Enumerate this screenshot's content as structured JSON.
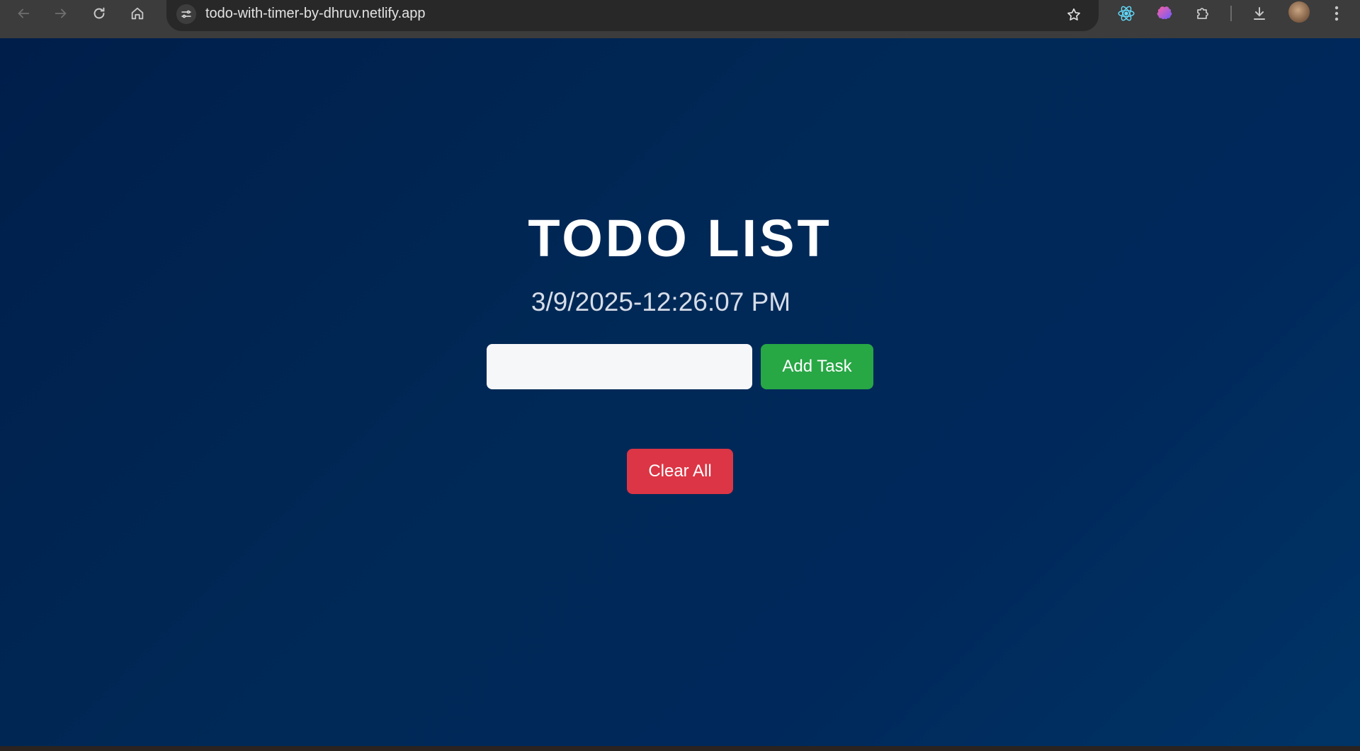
{
  "browser": {
    "url": "todo-with-timer-by-dhruv.netlify.app",
    "icons": {
      "back": "back-arrow-icon",
      "forward": "forward-arrow-icon",
      "reload": "reload-icon",
      "home": "home-icon",
      "site_info": "tune-icon",
      "bookmark": "star-icon",
      "extension_react": "react-devtools-icon",
      "extension_brain": "brain-extension-icon",
      "extensions": "puzzle-icon",
      "downloads": "download-icon",
      "menu": "kebab-menu-icon"
    }
  },
  "app": {
    "title": "TODO LIST",
    "datetime": "3/9/2025-12:26:07 PM",
    "task_input": {
      "value": "",
      "placeholder": ""
    },
    "add_button_label": "Add Task",
    "clear_button_label": "Clear All"
  },
  "colors": {
    "background": "#002250",
    "add_button": "#28a745",
    "clear_button": "#dc3545",
    "title_text": "#ffffff"
  }
}
